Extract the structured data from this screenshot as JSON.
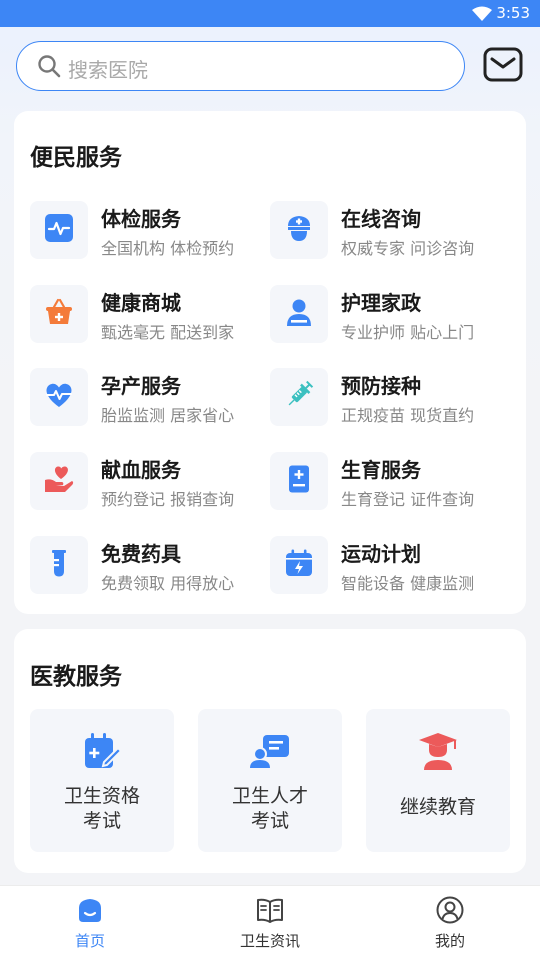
{
  "status_bar": {
    "time": "3:53"
  },
  "search": {
    "placeholder": "搜索医院"
  },
  "convenience": {
    "title": "便民服务",
    "items": [
      {
        "name": "体检服务",
        "desc": "全国机构 体检预约",
        "icon": "pulse-icon"
      },
      {
        "name": "在线咨询",
        "desc": "权威专家 问诊咨询",
        "icon": "nurse-cap-icon"
      },
      {
        "name": "健康商城",
        "desc": "甄选毫无 配送到家",
        "icon": "shopping-basket-icon"
      },
      {
        "name": "护理家政",
        "desc": "专业护师 贴心上门",
        "icon": "caregiver-icon"
      },
      {
        "name": "孕产服务",
        "desc": "胎监监测 居家省心",
        "icon": "heartbeat-icon"
      },
      {
        "name": "预防接种",
        "desc": "正规疫苗 现货直约",
        "icon": "syringe-icon"
      },
      {
        "name": "献血服务",
        "desc": "预约登记 报销查询",
        "icon": "hand-heart-icon"
      },
      {
        "name": "生育服务",
        "desc": "生育登记 证件查询",
        "icon": "medical-book-icon"
      },
      {
        "name": "免费药具",
        "desc": "免费领取 用得放心",
        "icon": "test-tube-icon"
      },
      {
        "name": "运动计划",
        "desc": "智能设备 健康监测",
        "icon": "calendar-bolt-icon"
      }
    ]
  },
  "medical_edu": {
    "title": "医教服务",
    "items": [
      {
        "line1": "卫生资格",
        "line2": "考试",
        "icon": "edit-certificate-icon"
      },
      {
        "line1": "卫生人才",
        "line2": "考试",
        "icon": "user-card-icon"
      },
      {
        "line1": "继续教育",
        "line2": "",
        "icon": "graduation-cap-icon"
      }
    ]
  },
  "tabs": [
    {
      "label": "首页",
      "icon": "home-icon",
      "active": true
    },
    {
      "label": "卫生资讯",
      "icon": "book-icon",
      "active": false
    },
    {
      "label": "我的",
      "icon": "profile-icon",
      "active": false
    }
  ],
  "colors": {
    "accent": "#3d86f5",
    "orange": "#f47b3a",
    "red": "#ec5a5a",
    "teal": "#3cc0c0"
  }
}
